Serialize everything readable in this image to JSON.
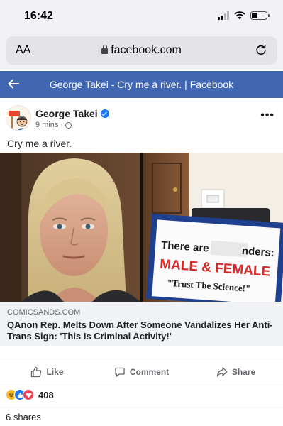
{
  "status_bar": {
    "time": "16:42"
  },
  "browser": {
    "text_size_label": "AA",
    "url": "facebook.com"
  },
  "fb_header": {
    "title": "George Takei - Cry me a river. | Facebook"
  },
  "post": {
    "author": "George Takei",
    "verified": true,
    "time_ago": "9 mins",
    "audience_icon": "globe-icon",
    "text": "Cry me a river.",
    "sign_lines": [
      "There are",
      "nders:",
      "MALE & FEMALE",
      "\"Trust The Science!\""
    ]
  },
  "link_card": {
    "domain": "COMICSANDS.COM",
    "headline": "QAnon Rep. Melts Down After Someone Vandalizes Her Anti-Trans Sign: 'This Is Criminal Activity!'"
  },
  "actions": {
    "like_label": "Like",
    "comment_label": "Comment",
    "share_label": "Share"
  },
  "engagement": {
    "reaction_count": "408",
    "shares_text": "6 shares",
    "reaction_icons": [
      "haha-icon",
      "like-icon",
      "love-icon"
    ]
  },
  "colors": {
    "facebook_blue": "#4267b2",
    "verified_blue": "#1877f2",
    "sign_red": "#d42a2a"
  }
}
